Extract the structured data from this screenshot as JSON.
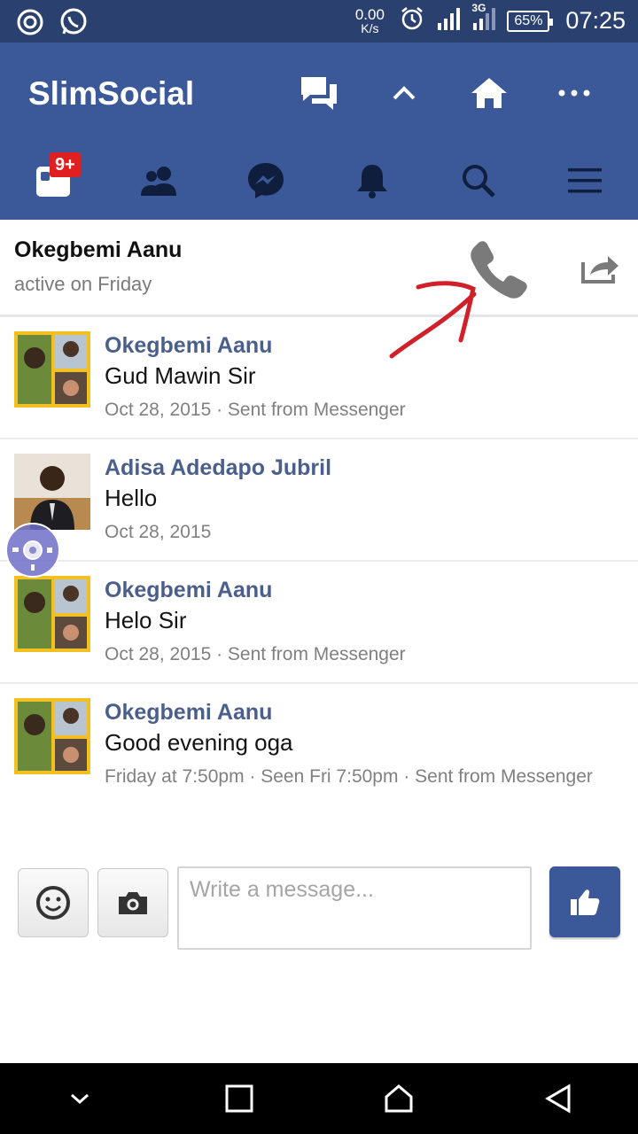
{
  "status_bar": {
    "net_speed_value": "0.00",
    "net_speed_unit": "K/s",
    "network_type": "3G",
    "battery": "65%",
    "time": "07:25"
  },
  "app": {
    "title": "SlimSocial",
    "notification_badge": "9+",
    "colors": {
      "primary": "#3b5998",
      "status_bar": "#2a4170",
      "sender_name": "#4b5f8d"
    }
  },
  "conversation": {
    "name": "Okegbemi Aanu",
    "status": "active on Friday"
  },
  "messages": [
    {
      "sender": "Okegbemi Aanu",
      "text": "Gud Mawin Sir",
      "meta": "Oct 28, 2015 · Sent from Messenger"
    },
    {
      "sender": "Adisa Adedapo Jubril",
      "text": "Hello",
      "meta": "Oct 28, 2015"
    },
    {
      "sender": "Okegbemi Aanu",
      "text": "Helo Sir",
      "meta": "Oct 28, 2015 · Sent from Messenger"
    },
    {
      "sender": "Okegbemi Aanu",
      "text": "Good evening oga",
      "meta": "Friday at 7:50pm · Seen Fri 7:50pm · Sent from Messenger"
    }
  ],
  "composer": {
    "placeholder": "Write a message..."
  }
}
